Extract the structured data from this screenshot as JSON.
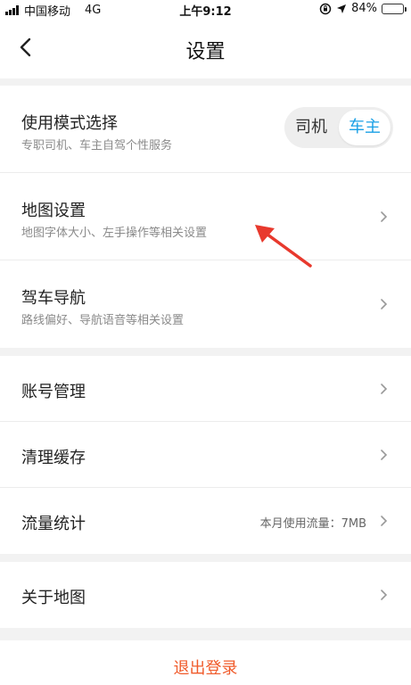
{
  "status_bar": {
    "carrier": "中国移动",
    "network": "4G",
    "time": "上午9:12",
    "battery": "84%",
    "battery_level": 0.84
  },
  "nav": {
    "title": "设置"
  },
  "group1": {
    "mode": {
      "title": "使用模式选择",
      "subtitle": "专职司机、车主自驾个性服务",
      "option_driver": "司机",
      "option_owner": "车主",
      "selected": "车主"
    },
    "map": {
      "title": "地图设置",
      "subtitle": "地图字体大小、左手操作等相关设置"
    },
    "nav_drive": {
      "title": "驾车导航",
      "subtitle": "路线偏好、导航语音等相关设置"
    }
  },
  "group2": {
    "account": {
      "title": "账号管理"
    },
    "cache": {
      "title": "清理缓存"
    },
    "traffic": {
      "title": "流量统计",
      "value": "本月使用流量：7MB"
    }
  },
  "group3": {
    "about": {
      "title": "关于地图"
    }
  },
  "logout": {
    "label": "退出登录"
  },
  "colors": {
    "accent": "#1aa0e6",
    "logout": "#f05a2a",
    "annotation": "#e8392d"
  }
}
